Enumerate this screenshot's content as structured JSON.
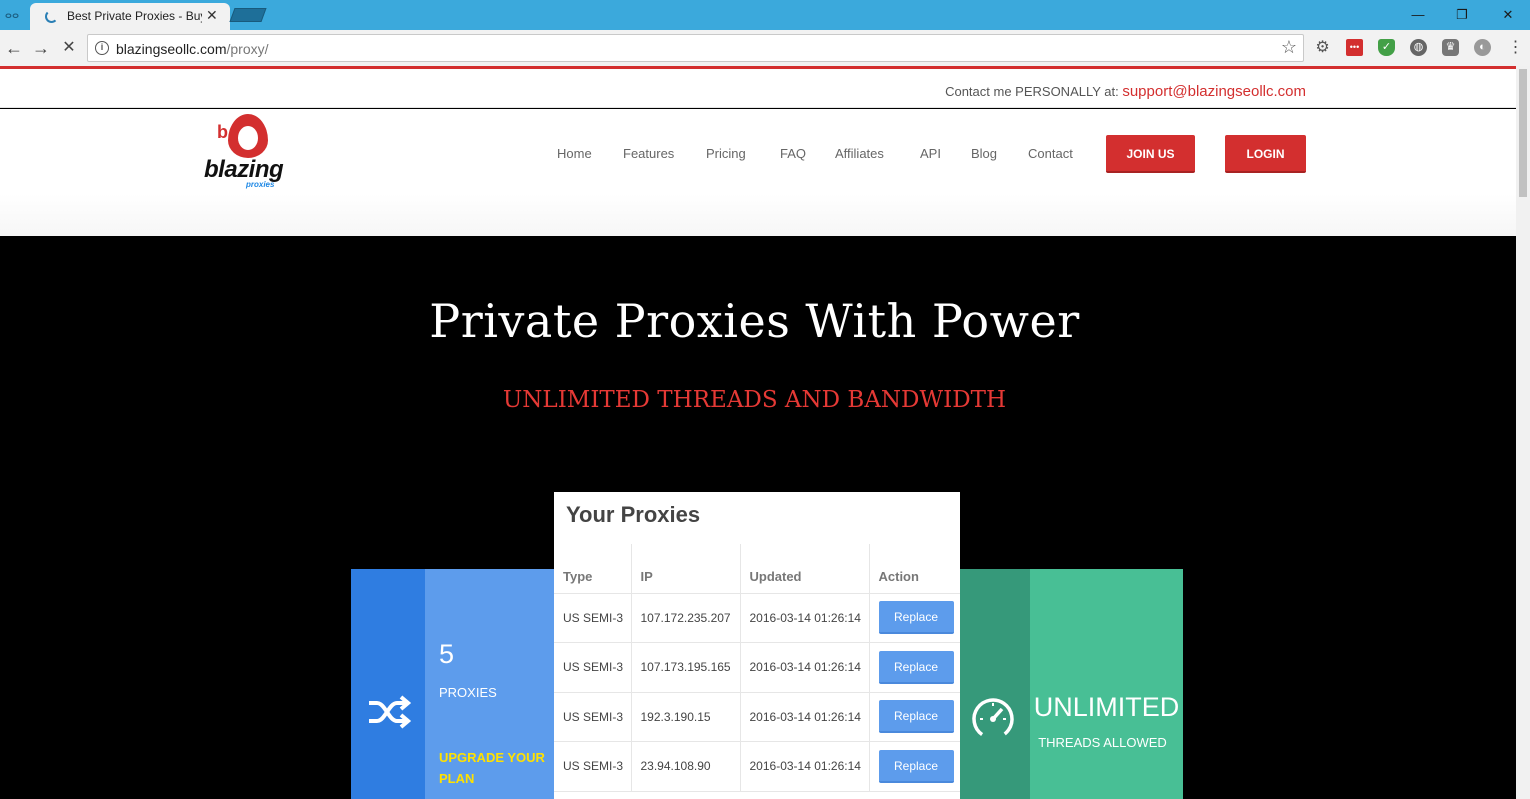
{
  "browser": {
    "tab_title": "Best Private Proxies - Buy",
    "url_host": "blazingseollc.com",
    "url_path": "/proxy/",
    "new_tab_label": ""
  },
  "topbar": {
    "contact_prefix": "Contact me PERSONALLY at: ",
    "contact_email": "support@blazingseollc.com"
  },
  "logo": {
    "name": "blazing",
    "sub": "proxies",
    "mark": "b"
  },
  "nav": {
    "items": [
      "Home",
      "Features",
      "Pricing",
      "FAQ",
      "Affiliates",
      "API",
      "Blog",
      "Contact"
    ],
    "join_label": "JOIN US",
    "login_label": "LOGIN"
  },
  "hero": {
    "title": "Private Proxies With Power",
    "subtitle": "UNLIMITED THREADS AND BANDWIDTH"
  },
  "stats_left": {
    "count": "5",
    "label": "PROXIES",
    "upgrade": "UPGRADE YOUR PLAN",
    "icon": "shuffle-icon"
  },
  "stats_right": {
    "value": "UNLIMITED",
    "label": "THREADS ALLOWED",
    "icon": "speedometer-icon"
  },
  "proxies": {
    "title": "Your Proxies",
    "headers": [
      "Type",
      "IP",
      "Updated",
      "Action"
    ],
    "rows": [
      {
        "type": "US SEMI-3",
        "ip": "107.172.235.207",
        "updated": "2016-03-14 01:26:14",
        "action": "Replace"
      },
      {
        "type": "US SEMI-3",
        "ip": "107.173.195.165",
        "updated": "2016-03-14 01:26:14",
        "action": "Replace"
      },
      {
        "type": "US SEMI-3",
        "ip": "192.3.190.15",
        "updated": "2016-03-14 01:26:14",
        "action": "Replace"
      },
      {
        "type": "US SEMI-3",
        "ip": "23.94.108.90",
        "updated": "2016-03-14 01:26:14",
        "action": "Replace"
      }
    ]
  },
  "colors": {
    "brand_red": "#d32f2f",
    "blue_dark": "#2f7de1",
    "blue_light": "#5d9cec",
    "green_dark": "#36997a",
    "green_light": "#48bf95",
    "upgrade_yellow": "#ffe100"
  }
}
